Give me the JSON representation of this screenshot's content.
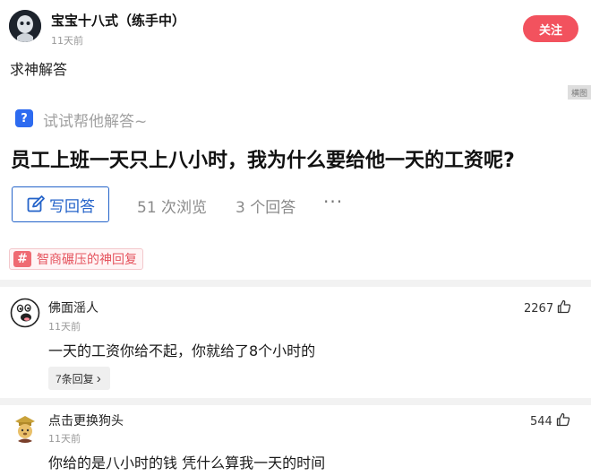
{
  "post": {
    "username": "宝宝十八式（练手中）",
    "time": "11天前",
    "follow_label": "关注",
    "body": "求神解答",
    "side_tag": "横图"
  },
  "question": {
    "icon_char": "?",
    "helper_prompt": "试试帮他解答~",
    "title": "员工上班一天只上八小时，我为什么要给他一天的工资呢?",
    "write_answer_label": "写回答",
    "views": "51 次浏览",
    "answers": "3 个回答",
    "more": "···"
  },
  "topic": {
    "hash": "#",
    "label": "智商碾压的神回复"
  },
  "comments": [
    {
      "name": "佛面滛人",
      "time": "11天前",
      "text": "一天的工资你给不起，你就给了8个小时的",
      "likes": "2267",
      "replies": "7条回复",
      "reply_chevron": "›"
    },
    {
      "name": "点击更换狗头",
      "time": "11天前",
      "text": "你给的是八小时的钱 凭什么算我一天的时间",
      "likes": "544"
    }
  ],
  "colors": {
    "follow": "#f2525e",
    "accent_blue": "#2463c9",
    "topic_red": "#e5545e"
  },
  "icons": [
    "avatar",
    "question-icon",
    "edit-icon",
    "hash-icon",
    "thumbs-up-icon",
    "chevron-right-icon"
  ]
}
